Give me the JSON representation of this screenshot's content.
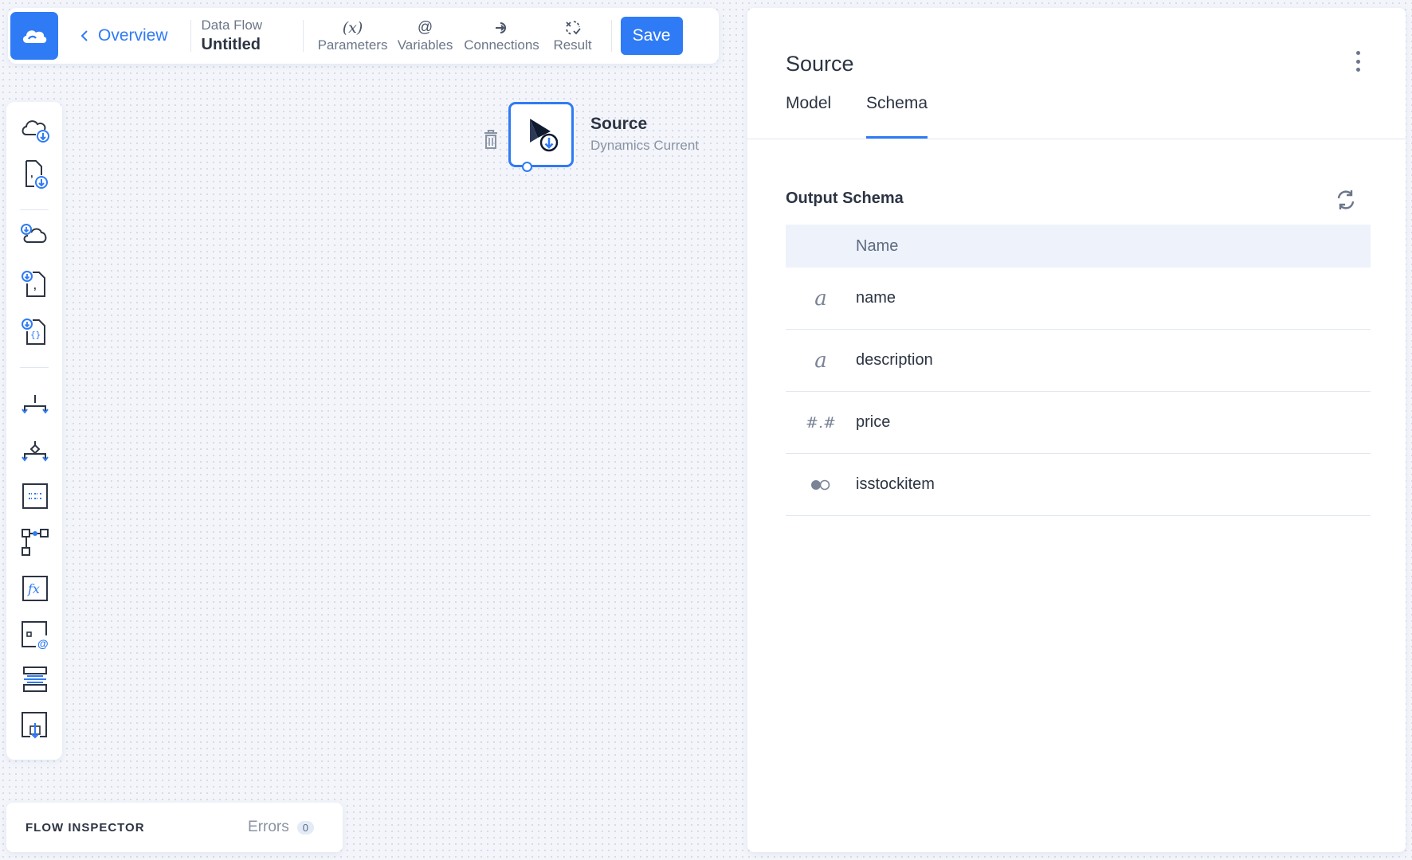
{
  "toolbar": {
    "back_label": "Overview",
    "flow_type": "Data Flow",
    "flow_name": "Untitled",
    "tools": [
      {
        "label": "Parameters",
        "icon": "parameters-icon",
        "glyph": "(x)"
      },
      {
        "label": "Variables",
        "icon": "variables-icon",
        "glyph": "@"
      },
      {
        "label": "Connections",
        "icon": "connections-icon",
        "glyph": ""
      },
      {
        "label": "Result",
        "icon": "result-icon",
        "glyph": ""
      }
    ],
    "save_label": "Save"
  },
  "palette": {
    "items": [
      "cloud-source-icon",
      "csv-source-icon",
      "cloud-target-icon",
      "csv-target-icon",
      "json-target-icon",
      "split-icon",
      "merge-icon",
      "transform-icon",
      "lookup-icon",
      "expression-icon",
      "variable-icon",
      "unpivot-icon",
      "import-icon"
    ]
  },
  "canvas": {
    "node": {
      "title": "Source",
      "subtitle": "Dynamics Current"
    }
  },
  "inspector": {
    "label": "FLOW INSPECTOR",
    "errors_label": "Errors",
    "errors_count": "0"
  },
  "panel": {
    "title": "Source",
    "tabs": [
      {
        "label": "Model",
        "active": false
      },
      {
        "label": "Schema",
        "active": true
      }
    ],
    "section_title": "Output Schema",
    "column_header": "Name",
    "fields": [
      {
        "type": "string",
        "type_glyph": "a",
        "name": "name"
      },
      {
        "type": "string",
        "type_glyph": "a",
        "name": "description"
      },
      {
        "type": "number",
        "type_glyph": "#.#",
        "name": "price"
      },
      {
        "type": "boolean",
        "type_glyph": "",
        "name": "isstockitem"
      }
    ]
  },
  "colors": {
    "accent": "#2f7bf5",
    "text": "#2c3443",
    "muted": "#8a93a3",
    "header_bg": "#eef2fb"
  }
}
